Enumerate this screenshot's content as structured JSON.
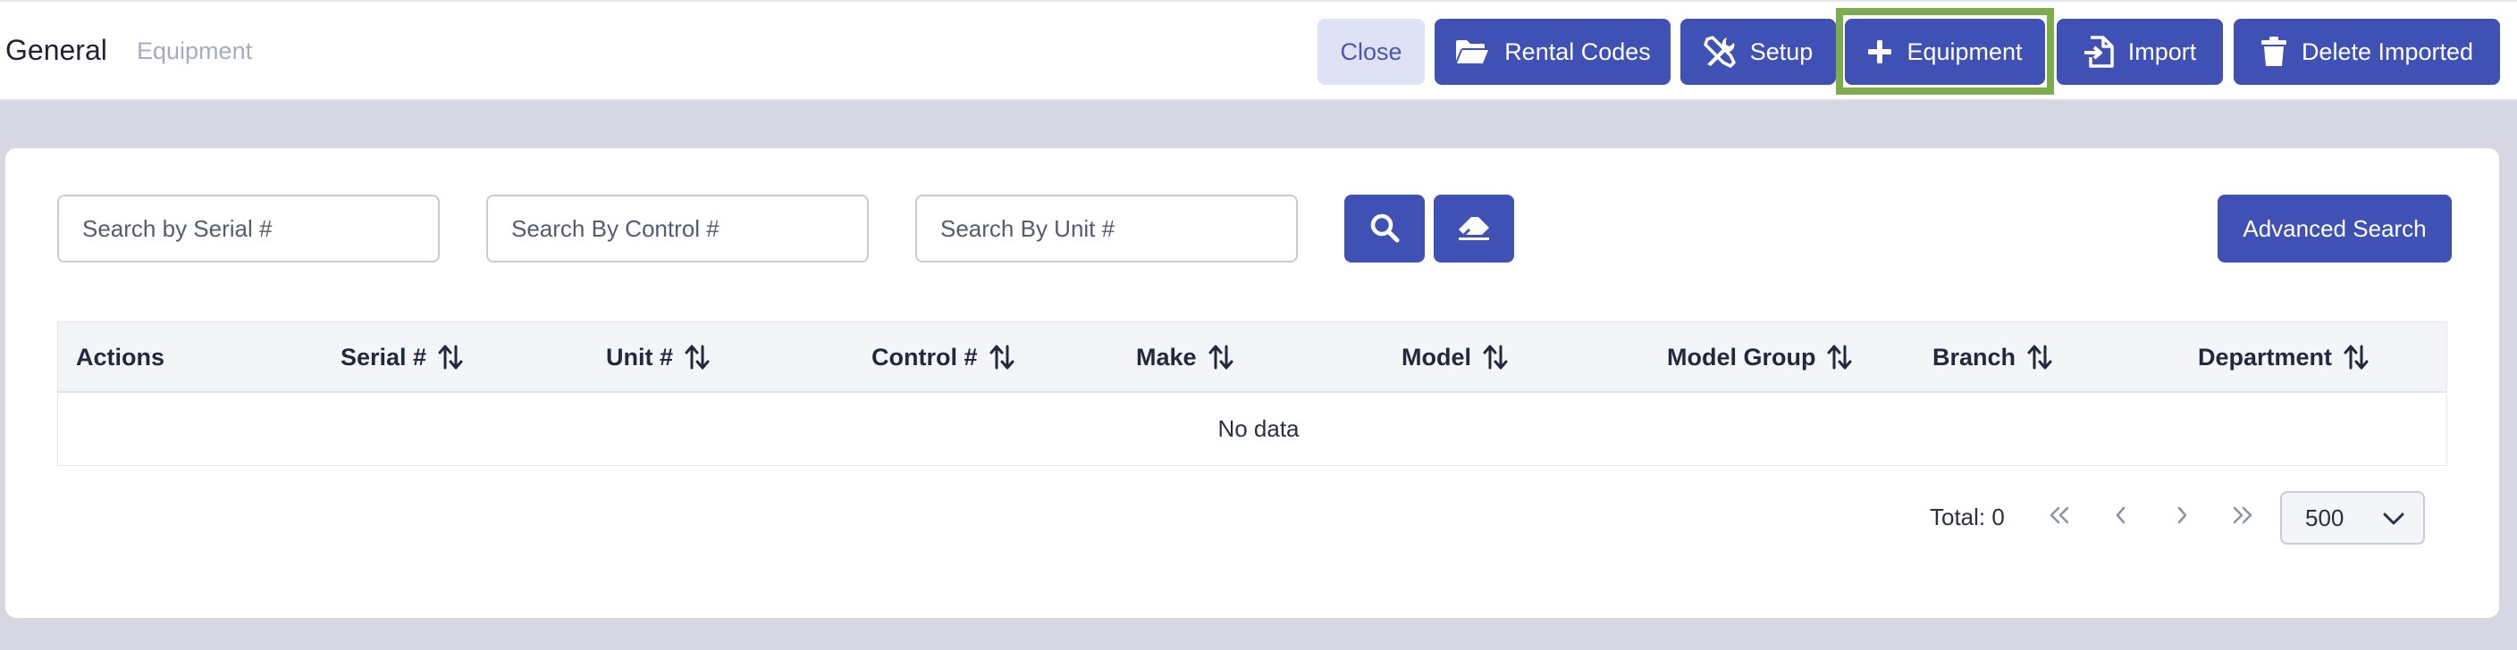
{
  "header": {
    "breadcrumb_primary": "General",
    "breadcrumb_secondary": "Equipment",
    "buttons": {
      "close": "Close",
      "rental_codes": "Rental Codes",
      "setup": "Setup",
      "equipment": "Equipment",
      "import": "Import",
      "delete_imported": "Delete Imported"
    },
    "highlighted_button": "equipment"
  },
  "search": {
    "serial_placeholder": "Search by Serial #",
    "control_placeholder": "Search By Control #",
    "unit_placeholder": "Search By Unit #",
    "advanced_label": "Advanced Search"
  },
  "table": {
    "columns": [
      "Actions",
      "Serial #",
      "Unit #",
      "Control #",
      "Make",
      "Model",
      "Model Group",
      "Branch",
      "Department"
    ],
    "rows": [],
    "empty_text": "No data"
  },
  "pagination": {
    "total_label": "Total: 0",
    "page_size": "500"
  },
  "icons": {
    "rental_codes": "folder-open-icon",
    "setup": "tools-icon",
    "equipment": "plus-icon",
    "import": "file-import-icon",
    "delete_imported": "trash-icon",
    "search": "search-icon",
    "clear": "eraser-icon",
    "sort": "sort-icon",
    "first": "chevrons-left-icon",
    "prev": "chevron-left-icon",
    "next": "chevron-right-icon",
    "last": "chevrons-right-icon",
    "dropdown": "chevron-down-icon"
  },
  "colors": {
    "primary": "#3f51b5",
    "close_bg": "#dfe1f5",
    "highlight": "#7dac4c",
    "page_bg": "#d6d7e2"
  }
}
